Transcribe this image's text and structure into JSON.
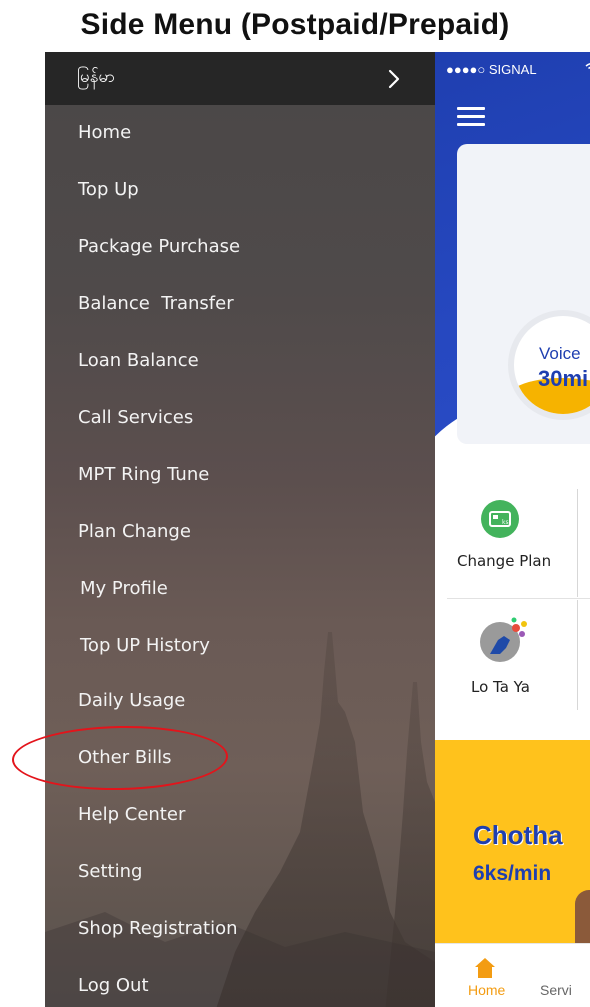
{
  "page_title": "Side Menu (Postpaid/Prepaid)",
  "side_menu": {
    "language_label": "မြန်မာ",
    "items": [
      {
        "label": "Home"
      },
      {
        "label": "Top Up"
      },
      {
        "label": "Package Purchase"
      },
      {
        "label": "Balance  Transfer"
      },
      {
        "label": "Loan Balance"
      },
      {
        "label": "Call Services"
      },
      {
        "label": "MPT Ring Tune"
      },
      {
        "label": "Plan Change"
      },
      {
        "label": "My Profile"
      },
      {
        "label": "Top UP History"
      },
      {
        "label": "Daily Usage"
      },
      {
        "label": "Other Bills"
      },
      {
        "label": "Help Center"
      },
      {
        "label": "Setting"
      },
      {
        "label": "Shop Registration"
      },
      {
        "label": "Log Out"
      }
    ],
    "highlighted_item": "Other Bills"
  },
  "app": {
    "status_bar": "●●●●○ SIGNAL",
    "balance_card": {
      "voice_label": "Voice",
      "voice_value": "30mi"
    },
    "tiles": [
      {
        "label": "Change Plan",
        "icon": "change-plan-icon"
      },
      {
        "label": "Lo Ta Ya",
        "icon": "lo-ta-ya-icon"
      }
    ],
    "promo": {
      "title": "Chotha",
      "price": "6ks/min"
    },
    "bottom_nav": {
      "home_label": "Home",
      "services_label": "Servi"
    }
  },
  "colors": {
    "menu_header": "#262626",
    "app_blue": "#1f3fb0",
    "promo_yellow": "#ffc21c",
    "highlight_red": "#e3141b",
    "home_orange": "#f39c12"
  }
}
